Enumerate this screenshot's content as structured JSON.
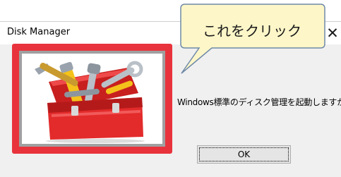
{
  "window": {
    "title": "Disk Manager",
    "close_glyph": "✕"
  },
  "dialog": {
    "message": "Windows標準のディスク管理を起動しますか",
    "ok_label": "OK",
    "image_icon": "toolbox-icon"
  },
  "callout": {
    "text": "これをクリック"
  },
  "colors": {
    "highlight_border": "#e8333c",
    "callout_fill": "#fdf6c8",
    "callout_stroke": "#6f8aa8",
    "dialog_bg": "#f0f0f0",
    "toolbox_red": "#e32b2b"
  }
}
